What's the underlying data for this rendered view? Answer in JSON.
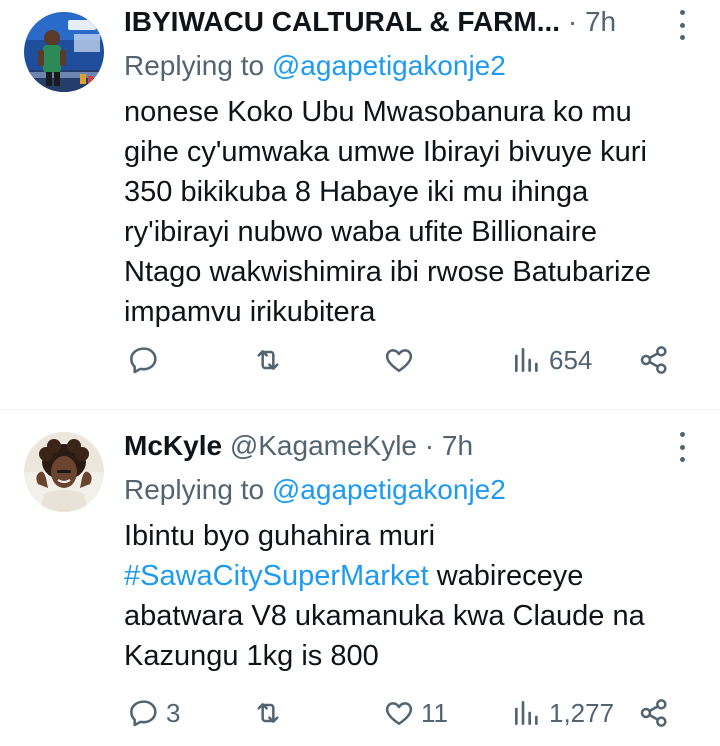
{
  "tweets": [
    {
      "name": "IBYIWACU CALTURAL & FARM...",
      "meta": " · 7h",
      "avatar_icon": "avatar-radio-studio",
      "replying_prefix": "Replying to ",
      "replying_to": "@agapetigakonje2",
      "lines": [
        "nonese Koko Ubu Mwasobanura ko mu",
        "gihe cy'umwaka umwe Ibirayi bivuye kuri",
        "350 bikikuba 8 Habaye iki mu ihinga",
        "ry'ibirayi nubwo waba ufite Billionaire",
        "Ntago wakwishimira ibi rwose Batubarize",
        "impamvu irikubitera"
      ],
      "replies": "",
      "retweets": "",
      "likes": "",
      "views": "654"
    },
    {
      "name": "McKyle",
      "meta": " @KagameKyle · 7h",
      "avatar_icon": "avatar-man-curly-hair",
      "replying_prefix": "Replying to ",
      "replying_to": "@agapetigakonje2",
      "line1": "Ibintu byo guhahira muri",
      "hashtag": "#SawaCitySuperMarket",
      "line2_rest": " wabireceye",
      "line3": "abatwara V8 ukamanuka kwa Claude na",
      "line4": "Kazungu 1kg is 800",
      "replies": "3",
      "retweets": "",
      "likes": "11",
      "views": "1,277"
    }
  ],
  "colors": {
    "text": "#0f1419",
    "secondary": "#536471",
    "link": "#1d9bf0",
    "divider": "#eff3f4"
  }
}
